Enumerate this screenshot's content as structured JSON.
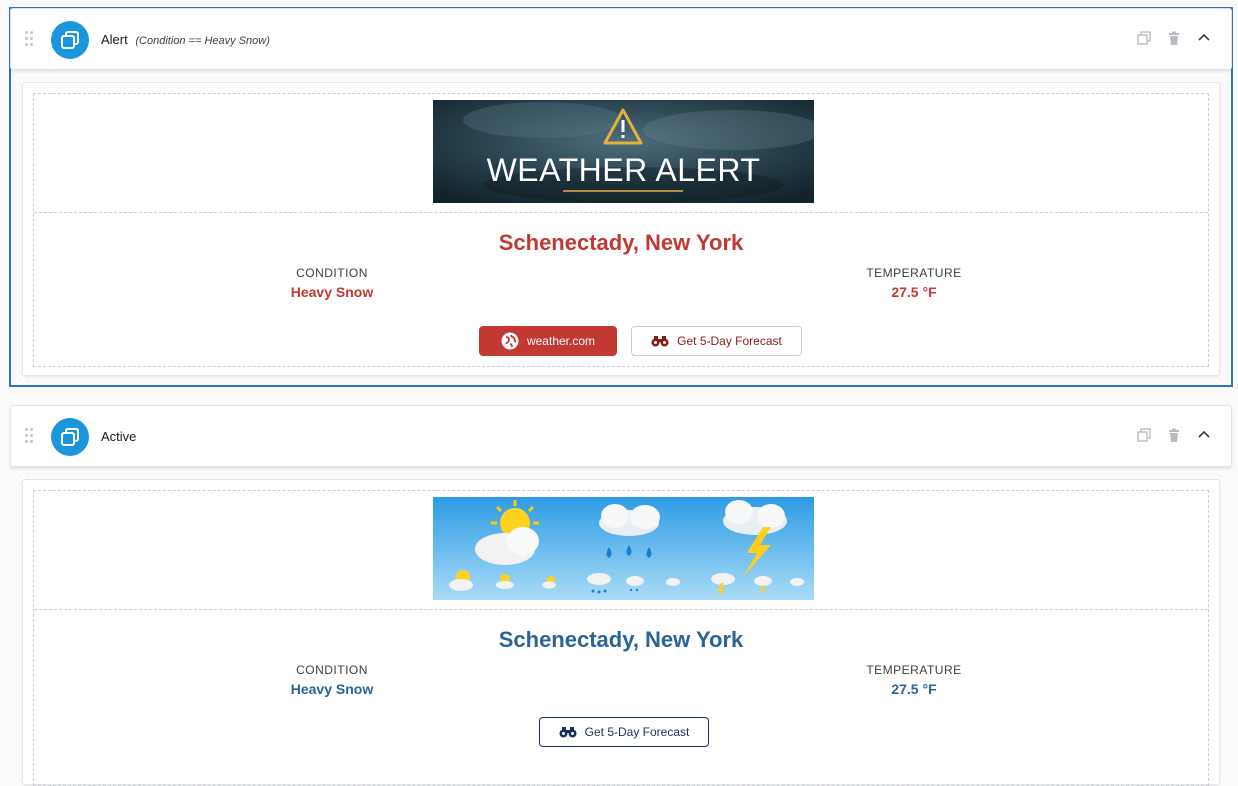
{
  "alert_panel": {
    "title": "Alert",
    "condition_expr": "(Condition == Heavy Snow)",
    "banner_text": "WEATHER ALERT",
    "city": "Schenectady, New York",
    "condition_label": "CONDITION",
    "condition_value": "Heavy Snow",
    "temperature_label": "TEMPERATURE",
    "temperature_value": "27.5 °F",
    "weather_button": "weather.com",
    "forecast_button": "Get 5-Day Forecast"
  },
  "active_panel": {
    "title": "Active",
    "city": "Schenectady, New York",
    "condition_label": "CONDITION",
    "condition_value": "Heavy Snow",
    "temperature_label": "TEMPERATURE",
    "temperature_value": "27.5 °F",
    "forecast_button": "Get 5-Day Forecast"
  },
  "colors": {
    "selection_outline": "#2e74c7",
    "alert_red": "#c23934",
    "active_blue": "#2a6496",
    "component_icon": "#1b96dc"
  },
  "icons": [
    "drag-handle-icon",
    "component-icon",
    "clone-icon",
    "delete-icon",
    "chevron-up-icon",
    "globe-icon",
    "binoculars-icon",
    "warning-triangle-icon"
  ]
}
